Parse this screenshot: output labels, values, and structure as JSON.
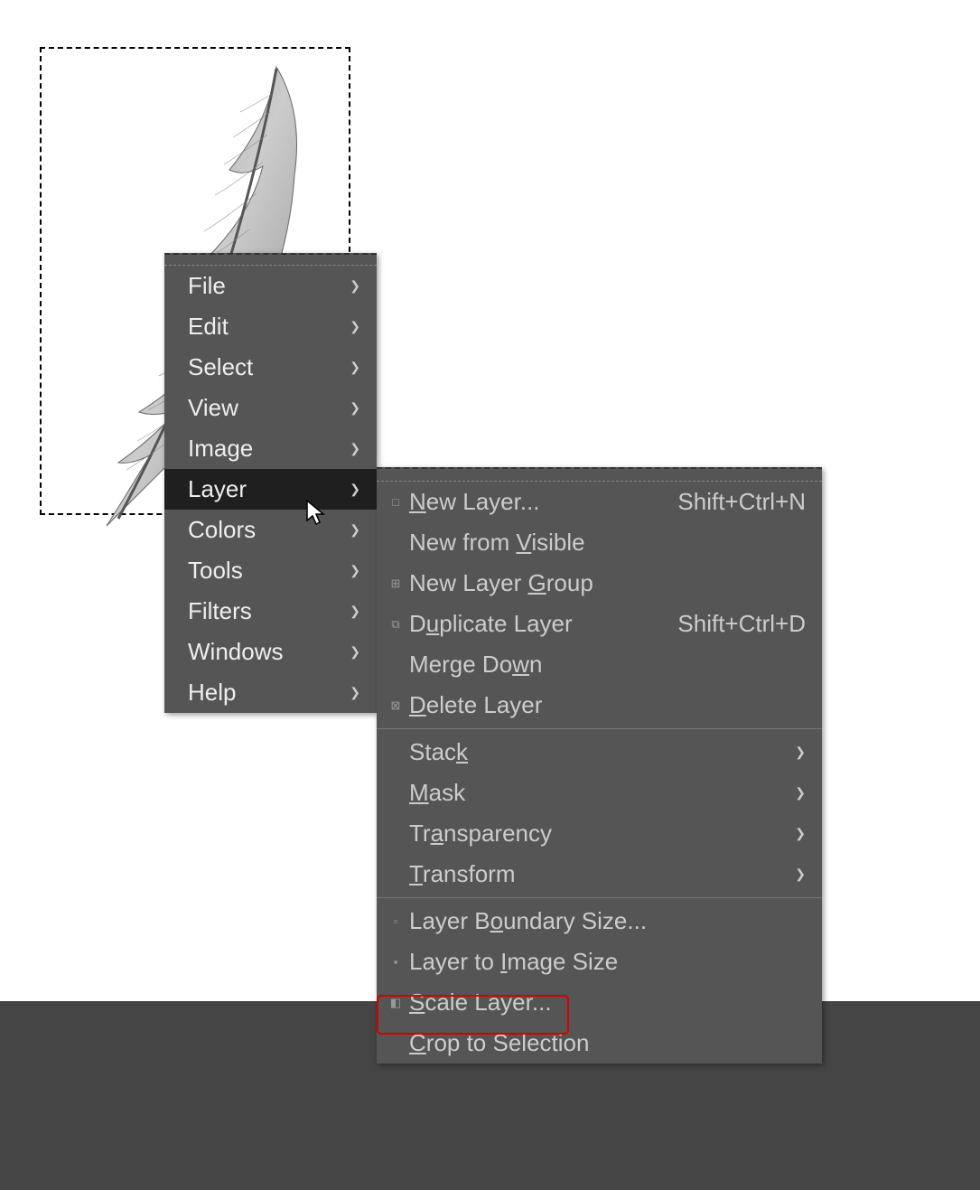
{
  "main_menu": [
    {
      "label": "File",
      "has_sub": true
    },
    {
      "label": "Edit",
      "has_sub": true
    },
    {
      "label": "Select",
      "has_sub": true
    },
    {
      "label": "View",
      "has_sub": true
    },
    {
      "label": "Image",
      "has_sub": true
    },
    {
      "label": "Layer",
      "has_sub": true,
      "highlighted": true
    },
    {
      "label": "Colors",
      "has_sub": true
    },
    {
      "label": "Tools",
      "has_sub": true
    },
    {
      "label": "Filters",
      "has_sub": true
    },
    {
      "label": "Windows",
      "has_sub": true
    },
    {
      "label": "Help",
      "has_sub": true
    }
  ],
  "submenu": {
    "groups": [
      [
        {
          "icon": "□",
          "label_pre": "",
          "u": "N",
          "label_post": "ew Layer...",
          "shortcut": "Shift+Ctrl+N"
        },
        {
          "icon": "",
          "label_pre": "New from ",
          "u": "V",
          "label_post": "isible",
          "shortcut": ""
        },
        {
          "icon": "⊞",
          "label_pre": "New Layer ",
          "u": "G",
          "label_post": "roup",
          "shortcut": ""
        },
        {
          "icon": "⧉",
          "label_pre": "D",
          "u": "u",
          "label_post": "plicate Layer",
          "shortcut": "Shift+Ctrl+D"
        },
        {
          "icon": "",
          "label_pre": "Merge Do",
          "u": "w",
          "label_post": "n",
          "shortcut": ""
        },
        {
          "icon": "⊠",
          "label_pre": "",
          "u": "D",
          "label_post": "elete Layer",
          "shortcut": ""
        }
      ],
      [
        {
          "icon": "",
          "label_pre": "Stac",
          "u": "k",
          "label_post": "",
          "has_sub": true
        },
        {
          "icon": "",
          "label_pre": "",
          "u": "M",
          "label_post": "ask",
          "has_sub": true
        },
        {
          "icon": "",
          "label_pre": "Tr",
          "u": "a",
          "label_post": "nsparency",
          "has_sub": true
        },
        {
          "icon": "",
          "label_pre": "",
          "u": "T",
          "label_post": "ransform",
          "has_sub": true
        }
      ],
      [
        {
          "icon": "▫",
          "label_pre": "Layer B",
          "u": "o",
          "label_post": "undary Size..."
        },
        {
          "icon": "▪",
          "label_pre": "Layer to ",
          "u": "I",
          "label_post": "mage Size"
        },
        {
          "icon": "◧",
          "label_pre": "",
          "u": "S",
          "label_post": "cale Layer...",
          "boxed": true
        },
        {
          "icon": "",
          "label_pre": "",
          "u": "C",
          "label_post": "rop to Selection"
        }
      ]
    ]
  }
}
